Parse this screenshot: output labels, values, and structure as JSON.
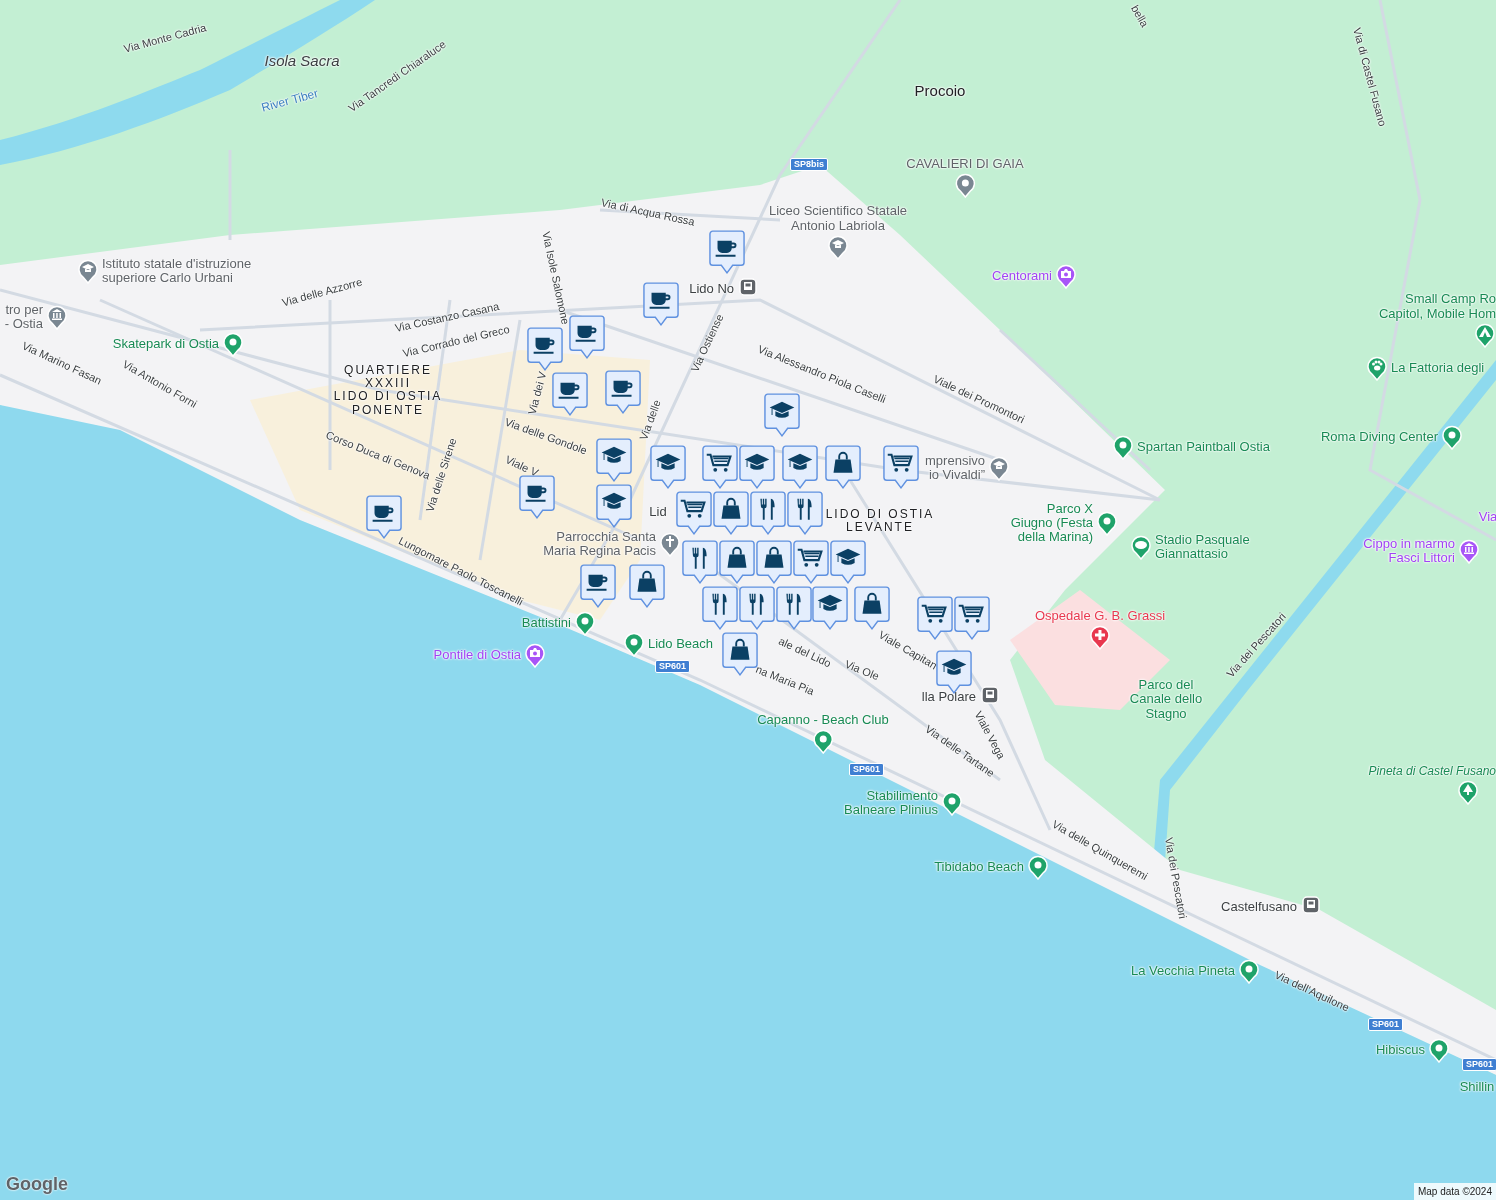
{
  "map": {
    "streets": [
      {
        "name": "Via Monte Cadria"
      },
      {
        "name": "Via Tancredi Chiaraluce"
      },
      {
        "name": "Via di Acqua Rossa"
      },
      {
        "name": "Via delle Azzorre"
      },
      {
        "name": "Via Costanzo Casana"
      },
      {
        "name": "Via Corrado del Greco"
      },
      {
        "name": "Via Isole Salomone"
      },
      {
        "name": "Via Ostiense"
      },
      {
        "name": "Via Alessandro Piola Caselli"
      },
      {
        "name": "Viale dei Promontori"
      },
      {
        "name": "Via Marino Fasan"
      },
      {
        "name": "Via Antonio Forni"
      },
      {
        "name": "Corso Duca di Genova"
      },
      {
        "name": "Via delle Sirene"
      },
      {
        "name": "Via delle Gondole"
      },
      {
        "name": "Viale V"
      },
      {
        "name": "Via dei V"
      },
      {
        "name": "Via delle"
      },
      {
        "name": "Lungomare Paolo Toscanelli"
      },
      {
        "name": "ale del Lido"
      },
      {
        "name": "na Maria Pia"
      },
      {
        "name": "Viale Capitan"
      },
      {
        "name": "Via Ole"
      },
      {
        "name": "Viale Vega"
      },
      {
        "name": "Via delle Tartane"
      },
      {
        "name": "Via delle Quinqueremi"
      },
      {
        "name": "Via dei Pescatori"
      },
      {
        "name": "Via dei Pescatori"
      },
      {
        "name": "Via dell'Aquilone"
      },
      {
        "name": "Via di Castel Fusano"
      },
      {
        "name": "bella"
      }
    ],
    "areas": [
      {
        "name": "Isola Sacra",
        "kind": "island"
      },
      {
        "name": "River Tiber",
        "kind": "water"
      },
      {
        "name": "Procoio",
        "kind": "locality"
      },
      {
        "name": "QUARTIERE\nXXXIII\nLIDO DI OSTIA\nPONENTE",
        "kind": "district"
      },
      {
        "name": "LIDO DI OSTIA\nLEVANTE",
        "kind": "district"
      },
      {
        "name": "Parco del\nCanale dello\nStagno",
        "kind": "park"
      },
      {
        "name": "Via",
        "kind": "attraction"
      },
      {
        "name": "Shillin",
        "kind": "park"
      },
      {
        "name": "Lid",
        "kind": "transit"
      }
    ],
    "pois": [
      {
        "name": "Istituto statale d'istruzione\nsuperiore Carlo Urbani",
        "kind": "school"
      },
      {
        "name": "tro per\n- Ostia",
        "kind": "museum"
      },
      {
        "name": "Skatepark di Ostia",
        "kind": "park"
      },
      {
        "name": "Liceo Scientifico Statale\nAntonio Labriola",
        "kind": "school"
      },
      {
        "name": "CAVALIERI DI GAIA",
        "kind": "place"
      },
      {
        "name": "Centorami",
        "kind": "attraction"
      },
      {
        "name": "Small Camp Ro\nCapitol, Mobile Hom",
        "kind": "camp"
      },
      {
        "name": "La Fattoria degli",
        "kind": "farm"
      },
      {
        "name": "Spartan Paintball Ostia",
        "kind": "park"
      },
      {
        "name": "Roma Diving Center",
        "kind": "park"
      },
      {
        "name": "mprensivo\nio Vivaldi”",
        "kind": "school"
      },
      {
        "name": "Parco X\nGiugno (Festa\ndella Marina)",
        "kind": "park"
      },
      {
        "name": "Parrocchia Santa\nMaria Regina Pacis",
        "kind": "church"
      },
      {
        "name": "Stadio Pasquale\nGiannattasio",
        "kind": "stadium"
      },
      {
        "name": "Cippo in marmo\nFasci Littori",
        "kind": "monument"
      },
      {
        "name": "Battistini",
        "kind": "park"
      },
      {
        "name": "Lido Beach",
        "kind": "park"
      },
      {
        "name": "Pontile di Ostia",
        "kind": "attraction"
      },
      {
        "name": "Ospedale G. B. Grassi",
        "kind": "hospital"
      },
      {
        "name": "Capanno - Beach Club",
        "kind": "park"
      },
      {
        "name": "Pineta di Castel Fusano",
        "kind": "forest"
      },
      {
        "name": "Stabilimento\nBalneare Plinius",
        "kind": "park"
      },
      {
        "name": "Tibidabo Beach",
        "kind": "park"
      },
      {
        "name": "La Vecchia Pineta",
        "kind": "park"
      },
      {
        "name": "Hibiscus",
        "kind": "park"
      },
      {
        "name": "Lido No",
        "kind": "station"
      },
      {
        "name": "lla Polare",
        "kind": "station"
      },
      {
        "name": "Castelfusano",
        "kind": "station"
      }
    ],
    "shields": [
      {
        "label": "SP8bis"
      },
      {
        "label": "SP601"
      },
      {
        "label": "SP601"
      },
      {
        "label": "SP601"
      },
      {
        "label": "SP601"
      }
    ],
    "markers": [
      {
        "kind": "cafe"
      },
      {
        "kind": "cafe"
      },
      {
        "kind": "cafe"
      },
      {
        "kind": "cafe"
      },
      {
        "kind": "cafe"
      },
      {
        "kind": "cafe"
      },
      {
        "kind": "cafe"
      },
      {
        "kind": "cafe"
      },
      {
        "kind": "cafe"
      },
      {
        "kind": "school"
      },
      {
        "kind": "school"
      },
      {
        "kind": "school"
      },
      {
        "kind": "school"
      },
      {
        "kind": "school"
      },
      {
        "kind": "school"
      },
      {
        "kind": "school"
      },
      {
        "kind": "school"
      },
      {
        "kind": "school"
      },
      {
        "kind": "cart"
      },
      {
        "kind": "cart"
      },
      {
        "kind": "cart"
      },
      {
        "kind": "cart"
      },
      {
        "kind": "cart"
      },
      {
        "kind": "cart"
      },
      {
        "kind": "bag"
      },
      {
        "kind": "bag"
      },
      {
        "kind": "bag"
      },
      {
        "kind": "bag"
      },
      {
        "kind": "bag"
      },
      {
        "kind": "bag"
      },
      {
        "kind": "bag"
      },
      {
        "kind": "restaurant"
      },
      {
        "kind": "restaurant"
      },
      {
        "kind": "restaurant"
      },
      {
        "kind": "restaurant"
      },
      {
        "kind": "restaurant"
      },
      {
        "kind": "restaurant"
      }
    ]
  },
  "attribution": {
    "logo": "Google",
    "text": "Map data ©2024"
  }
}
